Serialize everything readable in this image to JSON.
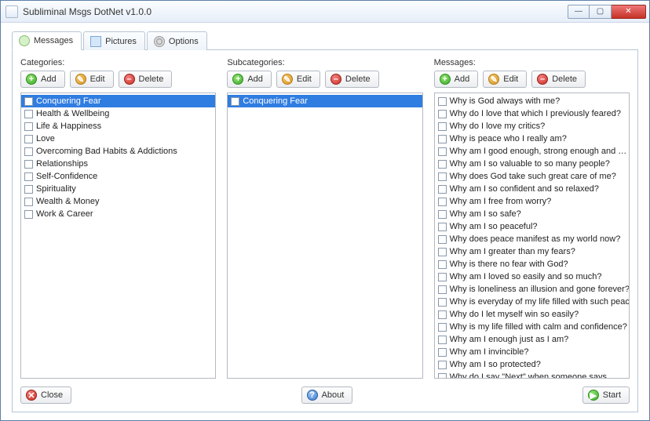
{
  "window": {
    "title": "Subliminal Msgs DotNet v1.0.0",
    "min": "—",
    "max": "▢",
    "close": "✕"
  },
  "tabs": [
    {
      "label": "Messages",
      "icon": "messages-tab-icon"
    },
    {
      "label": "Pictures",
      "icon": "pictures-tab-icon"
    },
    {
      "label": "Options",
      "icon": "options-tab-icon"
    }
  ],
  "active_tab": 0,
  "columns": {
    "categories": {
      "header": "Categories:",
      "buttons": {
        "add": "Add",
        "edit": "Edit",
        "delete": "Delete"
      },
      "items": [
        {
          "text": "Conquering Fear",
          "selected": true
        },
        {
          "text": "Health & Wellbeing"
        },
        {
          "text": "Life & Happiness"
        },
        {
          "text": "Love"
        },
        {
          "text": "Overcoming Bad Habits & Addictions"
        },
        {
          "text": "Relationships"
        },
        {
          "text": "Self-Confidence"
        },
        {
          "text": "Spirituality"
        },
        {
          "text": "Wealth & Money"
        },
        {
          "text": "Work & Career"
        }
      ]
    },
    "subcategories": {
      "header": "Subcategories:",
      "buttons": {
        "add": "Add",
        "edit": "Edit",
        "delete": "Delete"
      },
      "items": [
        {
          "text": "Conquering Fear",
          "selected": true
        }
      ]
    },
    "messages": {
      "header": "Messages:",
      "buttons": {
        "add": "Add",
        "edit": "Edit",
        "delete": "Delete"
      },
      "items": [
        {
          "text": "Why is God always with me?"
        },
        {
          "text": "Why do I love that which I previously feared?"
        },
        {
          "text": "Why do I love my critics?"
        },
        {
          "text": "Why is peace who I really am?"
        },
        {
          "text": "Why am I good enough, strong enough and …"
        },
        {
          "text": "Why am I so valuable to so many people?"
        },
        {
          "text": "Why does God take such great care of me?"
        },
        {
          "text": "Why am I so confident and so relaxed?"
        },
        {
          "text": "Why am I free from worry?"
        },
        {
          "text": "Why am I so safe?"
        },
        {
          "text": "Why am I so peaceful?"
        },
        {
          "text": "Why does peace manifest as my world now?"
        },
        {
          "text": "Why am I greater than my fears?"
        },
        {
          "text": "Why is there no fear with God?"
        },
        {
          "text": "Why am I loved so easily and so much?"
        },
        {
          "text": "Why is loneliness an illusion and gone forever?"
        },
        {
          "text": "Why is everyday of my life filled with such peace?"
        },
        {
          "text": "Why do I let myself win so easily?"
        },
        {
          "text": "Why is my life filled with calm and confidence?"
        },
        {
          "text": "Why am I enough just as I am?"
        },
        {
          "text": "Why am I invincible?"
        },
        {
          "text": "Why am I so protected?"
        },
        {
          "text": "Why do I say \"Next\" when someone says …"
        }
      ]
    }
  },
  "bottom": {
    "close": "Close",
    "about": "About",
    "start": "Start"
  }
}
